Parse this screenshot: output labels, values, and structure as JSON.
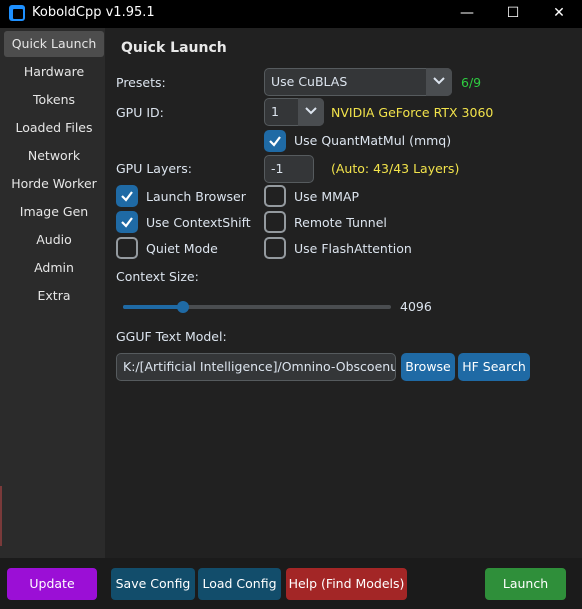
{
  "window": {
    "title": "KoboldCpp v1.95.1",
    "minimize_glyph": "—",
    "maximize_glyph": "☐",
    "close_glyph": "✕"
  },
  "sidebar": {
    "items": [
      {
        "label": "Quick Launch",
        "active": true
      },
      {
        "label": "Hardware"
      },
      {
        "label": "Tokens"
      },
      {
        "label": "Loaded Files"
      },
      {
        "label": "Network"
      },
      {
        "label": "Horde Worker"
      },
      {
        "label": "Image Gen"
      },
      {
        "label": "Audio"
      },
      {
        "label": "Admin"
      },
      {
        "label": "Extra"
      }
    ]
  },
  "main": {
    "heading": "Quick Launch",
    "presets": {
      "label": "Presets:",
      "value": "Use CuBLAS",
      "count": "6/9"
    },
    "gpu_id": {
      "label": "GPU ID:",
      "value": "1",
      "gpu_name": "NVIDIA GeForce RTX 3060"
    },
    "quantmatmul": {
      "label": "Use QuantMatMul (mmq)",
      "checked": true
    },
    "gpu_layers": {
      "label": "GPU Layers:",
      "value": "-1",
      "auto_text": "(Auto: 43/43 Layers)"
    },
    "checkboxes": {
      "launch_browser": {
        "label": "Launch Browser",
        "checked": true
      },
      "use_mmap": {
        "label": "Use MMAP",
        "checked": false
      },
      "context_shift": {
        "label": "Use ContextShift",
        "checked": true
      },
      "remote_tunnel": {
        "label": "Remote Tunnel",
        "checked": false
      },
      "quiet_mode": {
        "label": "Quiet Mode",
        "checked": false
      },
      "flash_attention": {
        "label": "Use FlashAttention",
        "checked": false
      }
    },
    "context_size": {
      "label": "Context Size:",
      "value": "4096",
      "slider_fraction": 0.225
    },
    "model": {
      "label": "GGUF Text Model:",
      "path": "K:/[Artificial Intelligence]/Omnino-Obscoenum-Opus",
      "browse_label": "Browse",
      "hf_search_label": "HF Search"
    }
  },
  "bottom": {
    "update_label": "Update",
    "save_config_label": "Save Config",
    "load_config_label": "Load Config",
    "help_label": "Help (Find Models)",
    "launch_label": "Launch"
  },
  "colors": {
    "accent": "#1f6aa5",
    "update": "#9b0fd6",
    "config": "#124d6b",
    "help": "#a32626",
    "launch": "#2f8f3a",
    "ok_text": "#2ecc40",
    "info_text": "#f2e34b"
  }
}
